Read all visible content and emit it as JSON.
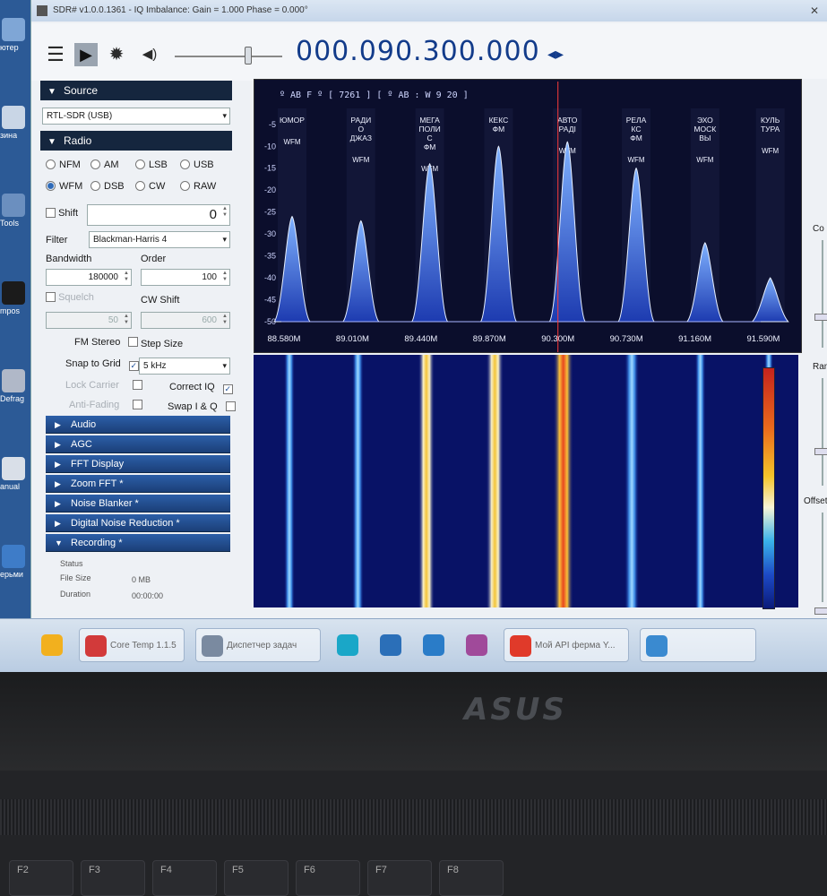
{
  "window": {
    "title": "SDR# v1.0.0.1361 - IQ Imbalance: Gain = 1.000 Phase = 0.000°",
    "close_glyph": "✕"
  },
  "desktop": {
    "icons": [
      {
        "label": "ютер",
        "color": "#7fa6d6"
      },
      {
        "label": "зина",
        "color": "#c9d6e6"
      },
      {
        "label": "Tools",
        "color": "#6b8fbf"
      },
      {
        "label": "mpos",
        "color": "#1b1b1b"
      },
      {
        "label": "Defrag",
        "color": "#b0b8c8"
      },
      {
        "label": "anual",
        "color": "#d9dfe8"
      },
      {
        "label": "ерьми",
        "color": "#3e7cc8"
      }
    ]
  },
  "toolbar": {
    "menu_icon": "☰",
    "play_icon": "▶",
    "gear_icon": "✹",
    "volume_icon": "◀)",
    "frequency": "000.090.300.000",
    "freq_arrows": "◂▸"
  },
  "source": {
    "header": "Source",
    "device": "RTL-SDR (USB)"
  },
  "radio": {
    "header": "Radio",
    "modes": [
      {
        "label": "NFM",
        "selected": false
      },
      {
        "label": "AM",
        "selected": false
      },
      {
        "label": "LSB",
        "selected": false
      },
      {
        "label": "USB",
        "selected": false
      },
      {
        "label": "WFM",
        "selected": true
      },
      {
        "label": "DSB",
        "selected": false
      },
      {
        "label": "CW",
        "selected": false
      },
      {
        "label": "RAW",
        "selected": false
      }
    ],
    "shift_label": "Shift",
    "shift_value": "0",
    "filter_label": "Filter",
    "filter_value": "Blackman-Harris 4",
    "bandwidth_label": "Bandwidth",
    "bandwidth_value": "180000",
    "order_label": "Order",
    "order_value": "100",
    "squelch_label": "Squelch",
    "squelch_value": "50",
    "cwshift_label": "CW Shift",
    "cwshift_value": "600",
    "fmstereo_label": "FM Stereo",
    "stepsize_label": "Step Size",
    "snap_label": "Snap to Grid",
    "snap_checked": "✓",
    "step_value": "5 kHz",
    "lockcarrier_label": "Lock Carrier",
    "correctiq_label": "Correct IQ",
    "correctiq_checked": "✓",
    "antifading_label": "Anti-Fading",
    "swapiq_label": "Swap I & Q"
  },
  "plugins": [
    {
      "label": "Audio",
      "expanded": false
    },
    {
      "label": "AGC",
      "expanded": false
    },
    {
      "label": "FFT Display",
      "expanded": false
    },
    {
      "label": "Zoom FFT *",
      "expanded": false
    },
    {
      "label": "Noise Blanker *",
      "expanded": false
    },
    {
      "label": "Digital Noise Reduction *",
      "expanded": false
    },
    {
      "label": "Recording *",
      "expanded": true
    }
  ],
  "recording": {
    "status_label": "Status",
    "filesize_label": "File Size",
    "filesize_value": "0 MB",
    "duration_label": "Duration",
    "duration_value": "00:00:00"
  },
  "spectrum": {
    "rds_line": "º AB F º [ 7261 ] [ º AB : W 9 20 ]",
    "y_ticks": [
      -5,
      -10,
      -15,
      -20,
      -25,
      -30,
      -35,
      -40,
      -45,
      -50
    ],
    "x_ticks": [
      "88.580M",
      "89.010M",
      "89.440M",
      "89.870M",
      "90.300M",
      "90.730M",
      "91.160M",
      "91.590M"
    ],
    "stations": [
      {
        "name": "ЮМОР",
        "mode": "WFM",
        "peak": -26
      },
      {
        "name": "РАДИ О ДЖАЗ",
        "mode": "WFM",
        "peak": -27
      },
      {
        "name": "МЕГА ПОЛИ С ФМ",
        "mode": "WFM",
        "peak": -14
      },
      {
        "name": "КЕКС ФМ",
        "mode": "",
        "peak": -10
      },
      {
        "name": "АВТО РАДI",
        "mode": "WFM",
        "peak": -9
      },
      {
        "name": "РЕЛА КС ФМ",
        "mode": "WFM",
        "peak": -15
      },
      {
        "name": "ЭХО МОСК ВЫ",
        "mode": "WFM",
        "peak": -32
      },
      {
        "name": "КУЛЬ ТУРА",
        "mode": "WFM",
        "peak": -40
      }
    ]
  },
  "waterfall": {
    "traces": [
      {
        "intensity": 0.25
      },
      {
        "intensity": 0.3
      },
      {
        "intensity": 0.7
      },
      {
        "intensity": 0.8
      },
      {
        "intensity": 1.0
      },
      {
        "intensity": 0.55
      },
      {
        "intensity": 0.25
      },
      {
        "intensity": 0.12
      }
    ]
  },
  "right_panel": {
    "contrast_label": "Co",
    "range_label": "Rang",
    "offset_label": "Offset"
  },
  "taskbar": {
    "items": [
      {
        "label": "",
        "color": "#f2b01e",
        "w": 36,
        "box": false
      },
      {
        "label": "Core Temp 1.1.5",
        "color": "#d23a3a",
        "w": 118,
        "box": true
      },
      {
        "label": "Диспетчер задач",
        "color": "#7a8aa0",
        "w": 140,
        "box": true
      },
      {
        "label": "",
        "color": "#1aa7c8",
        "w": 36,
        "box": false
      },
      {
        "label": "",
        "color": "#2b6fb8",
        "w": 36,
        "box": false
      },
      {
        "label": "",
        "color": "#2a7cc8",
        "w": 36,
        "box": false
      },
      {
        "label": "",
        "color": "#a04a9a",
        "w": 36,
        "box": false
      },
      {
        "label": "Мой API ферма Y...",
        "color": "#e03a2a",
        "w": 140,
        "box": true
      },
      {
        "label": "",
        "color": "#3a8ad0",
        "w": 130,
        "box": true
      }
    ]
  },
  "laptop": {
    "brand": "ASUS",
    "keys": [
      "F2",
      "F3",
      "F4",
      "F5",
      "F6",
      "F7",
      "F8"
    ]
  }
}
